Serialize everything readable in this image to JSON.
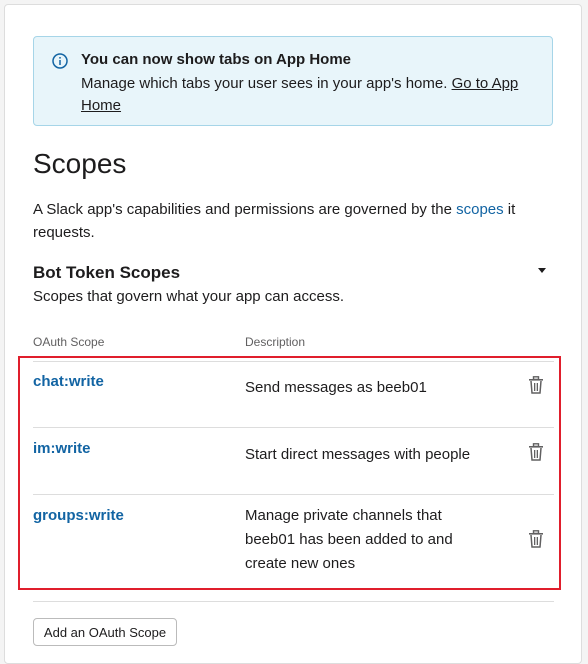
{
  "banner": {
    "icon": "info-icon",
    "title": "You can now show tabs on App Home",
    "body_text": "Manage which tabs your user sees in your app's home. ",
    "link_text": "Go to App Home"
  },
  "page_title": "Scopes",
  "intro": {
    "text_before": "A Slack app's capabilities and permissions are governed by the ",
    "link_text": "scopes",
    "text_after": " it requests."
  },
  "bot_token_scopes": {
    "title": "Bot Token Scopes",
    "description": "Scopes that govern what your app can access.",
    "toggle_icon": "caret-down-icon",
    "columns": [
      "OAuth Scope",
      "Description"
    ],
    "rows": [
      {
        "scope": "chat:write",
        "description": "Send messages as beeb01"
      },
      {
        "scope": "im:write",
        "description": "Start direct messages with people"
      },
      {
        "scope": "groups:write",
        "description": "Manage private channels that beeb01 has been added to and create new ones"
      }
    ],
    "delete_icon": "trash-icon",
    "add_button_label": "Add an OAuth Scope"
  },
  "colors": {
    "link": "#1264a3",
    "banner_bg": "#e8f5fa",
    "highlight_border": "#e01e2c"
  }
}
